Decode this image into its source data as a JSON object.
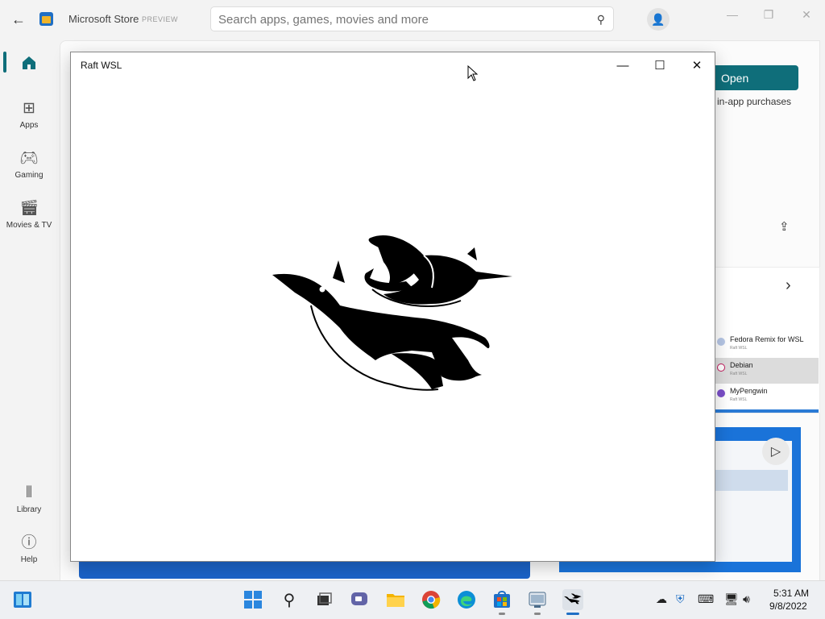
{
  "store": {
    "title": "Microsoft Store",
    "badge": "PREVIEW",
    "search_placeholder": "Search apps, games, movies and more",
    "nav": [
      {
        "label": "",
        "icon": "home-icon"
      },
      {
        "label": "Apps",
        "icon": "apps-icon"
      },
      {
        "label": "Gaming",
        "icon": "gaming-icon"
      },
      {
        "label": "Movies & TV",
        "icon": "movies-icon"
      },
      {
        "label": "Library",
        "icon": "library-icon"
      },
      {
        "label": "Help",
        "icon": "help-icon"
      }
    ],
    "open_button": "Open",
    "iap_text": "in-app purchases",
    "related": [
      {
        "title": "Fedora Remix for WSL",
        "sub": "Raft WSL"
      },
      {
        "title": "Debian",
        "sub": "Raft WSL"
      },
      {
        "title": "MyPengwin",
        "sub": "Raft WSL"
      }
    ],
    "accent_color": "#0f6e7a"
  },
  "raft": {
    "title": "Raft WSL"
  },
  "clock": {
    "time": "5:31 AM",
    "date": "9/8/2022"
  }
}
